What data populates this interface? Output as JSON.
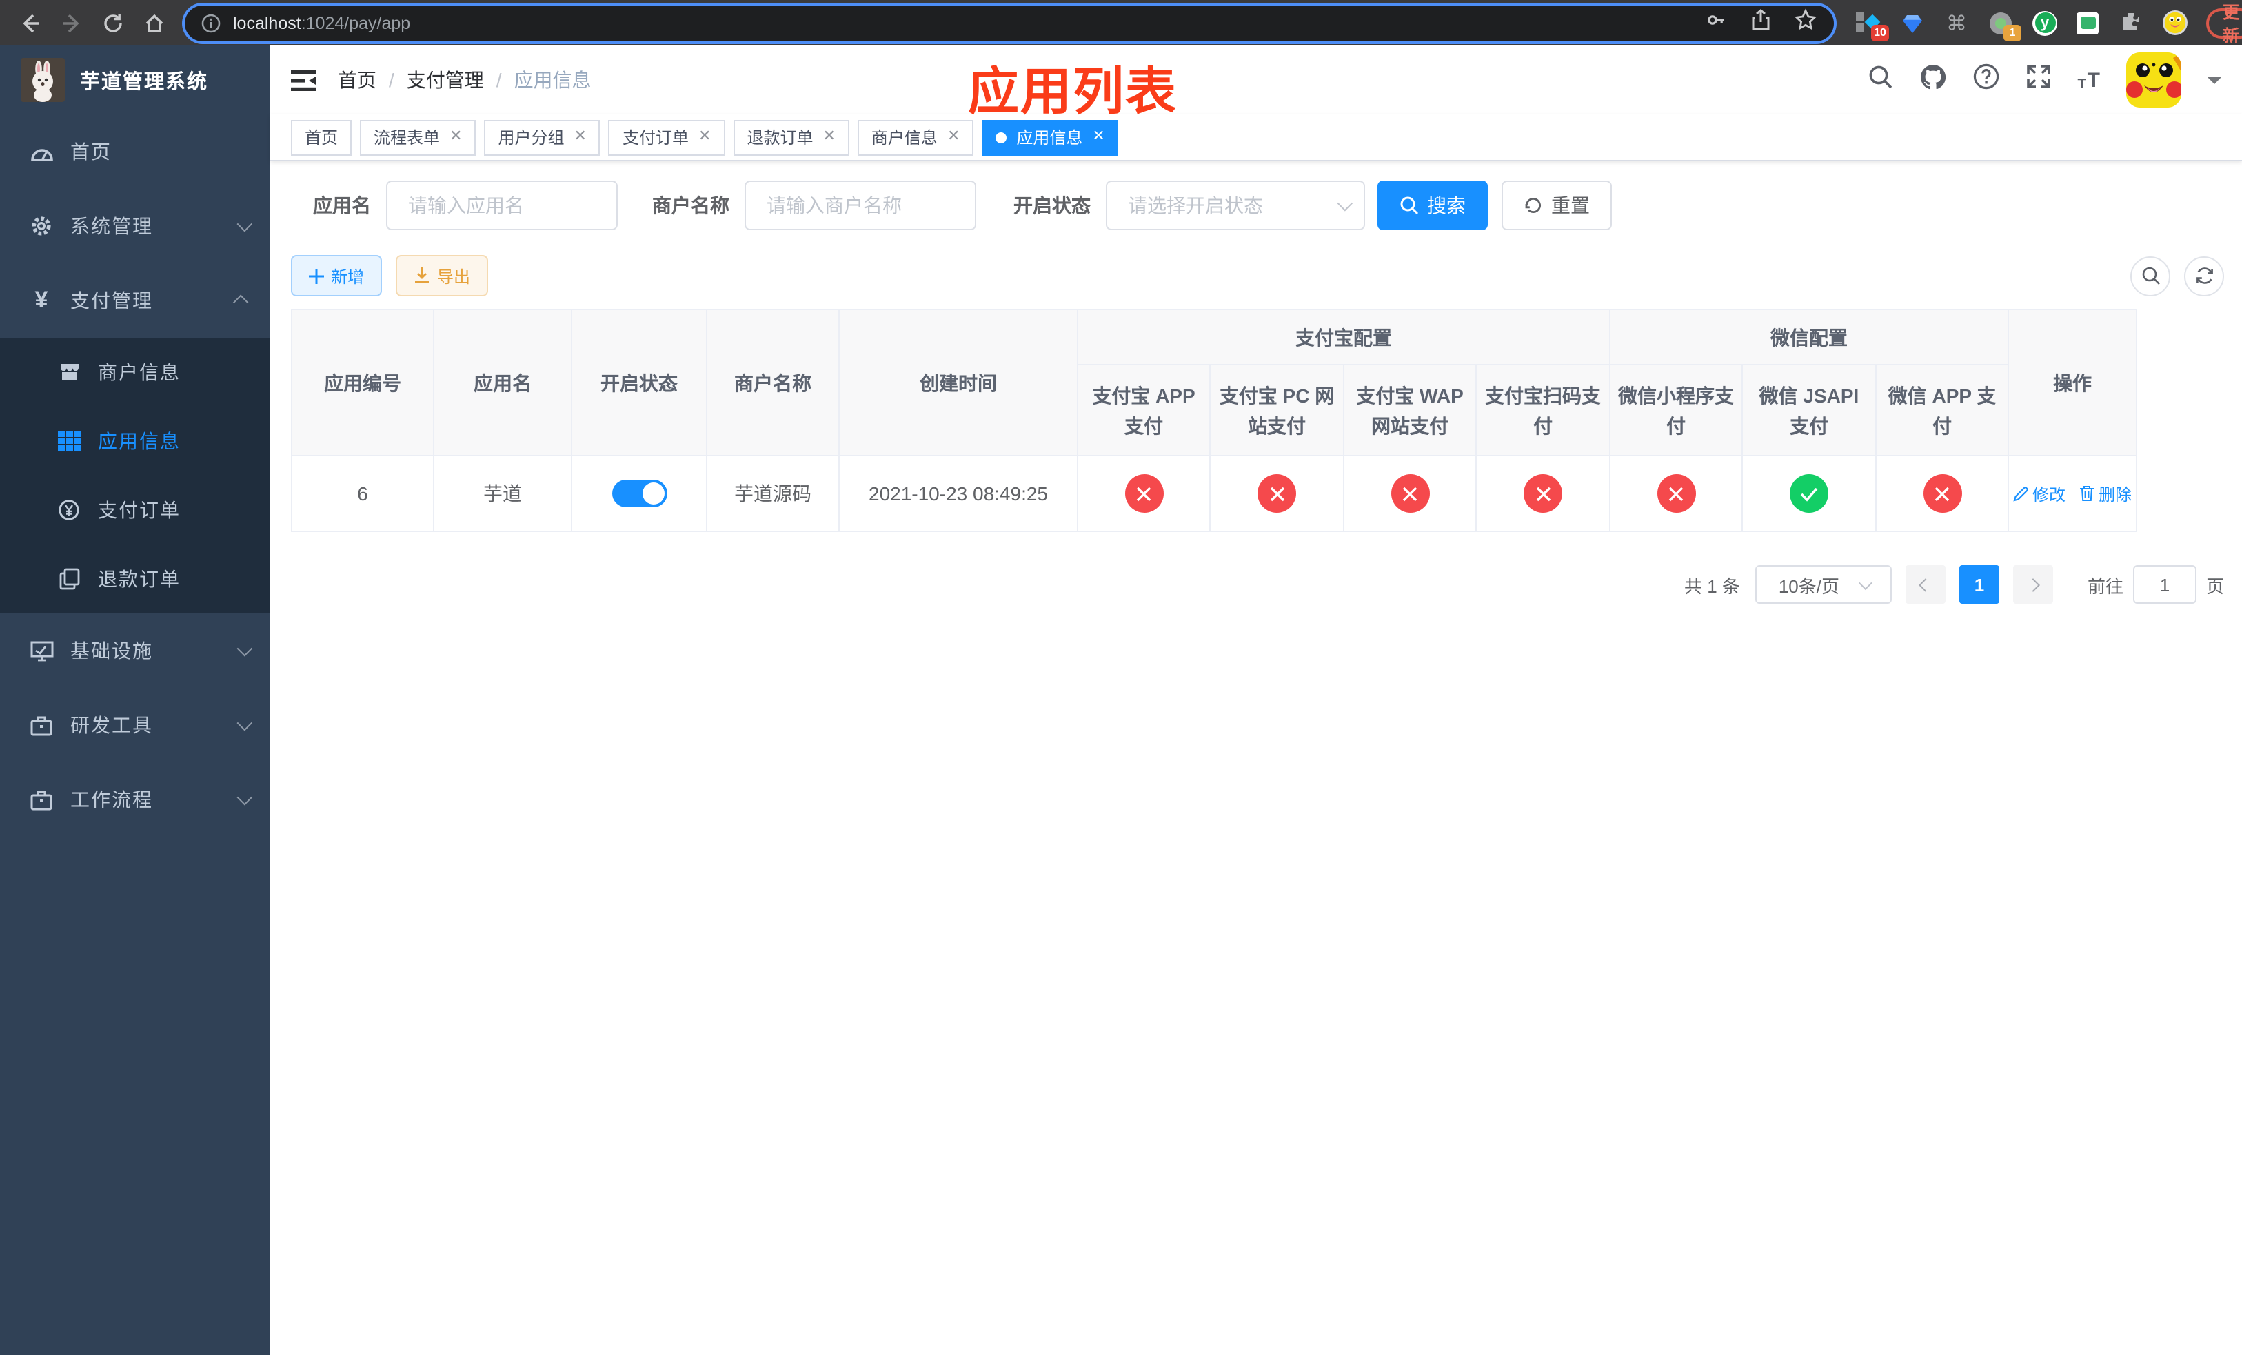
{
  "browser": {
    "url_host": "localhost",
    "url_rest": ":1024/pay/app",
    "ext_badge_tampermonkey": "10",
    "ext_badge_switcher": "1",
    "update_label": "更新"
  },
  "annotation": {
    "text": "应用列表"
  },
  "sidebar": {
    "title": "芋道管理系统",
    "items": [
      {
        "label": "首页"
      },
      {
        "label": "系统管理"
      },
      {
        "label": "支付管理"
      },
      {
        "label": "基础设施"
      },
      {
        "label": "研发工具"
      },
      {
        "label": "工作流程"
      }
    ],
    "submenu": [
      {
        "label": "商户信息"
      },
      {
        "label": "应用信息"
      },
      {
        "label": "支付订单"
      },
      {
        "label": "退款订单"
      }
    ]
  },
  "breadcrumb": {
    "items": [
      "首页",
      "支付管理",
      "应用信息"
    ]
  },
  "tabs": [
    {
      "label": "首页"
    },
    {
      "label": "流程表单"
    },
    {
      "label": "用户分组"
    },
    {
      "label": "支付订单"
    },
    {
      "label": "退款订单"
    },
    {
      "label": "商户信息"
    },
    {
      "label": "应用信息"
    }
  ],
  "filters": {
    "name_label": "应用名",
    "name_placeholder": "请输入应用名",
    "merchant_label": "商户名称",
    "merchant_placeholder": "请输入商户名称",
    "status_label": "开启状态",
    "status_placeholder": "请选择开启状态",
    "search": "搜索",
    "reset": "重置"
  },
  "toolbar": {
    "add": "新增",
    "export": "导出"
  },
  "table": {
    "groups": {
      "alipay": "支付宝配置",
      "wechat": "微信配置"
    },
    "columns": [
      "应用编号",
      "应用名",
      "开启状态",
      "商户名称",
      "创建时间",
      "支付宝 APP 支付",
      "支付宝 PC 网站支付",
      "支付宝 WAP 网站支付",
      "支付宝扫码支付",
      "微信小程序支付",
      "微信 JSAPI 支付",
      "微信 APP 支付",
      "操作"
    ],
    "rows": [
      {
        "id": "6",
        "name": "芋道",
        "enabled": true,
        "merchant": "芋道源码",
        "created": "2021-10-23 08:49:25",
        "channels": [
          "no",
          "no",
          "no",
          "no",
          "no",
          "yes",
          "no"
        ],
        "edit": "修改",
        "delete": "删除"
      }
    ]
  },
  "pagination": {
    "total": "共 1 条",
    "size": "10条/页",
    "page": "1",
    "goto": "前往",
    "goto_value": "1",
    "unit": "页"
  },
  "colors": {
    "primary": "#1890ff",
    "danger": "#f5494c",
    "success": "#13ce66",
    "warning": "#e6a23c",
    "sidebar_bg": "#304156",
    "submenu_bg": "#1f2d3d",
    "annotation_red": "#fa3c19"
  }
}
